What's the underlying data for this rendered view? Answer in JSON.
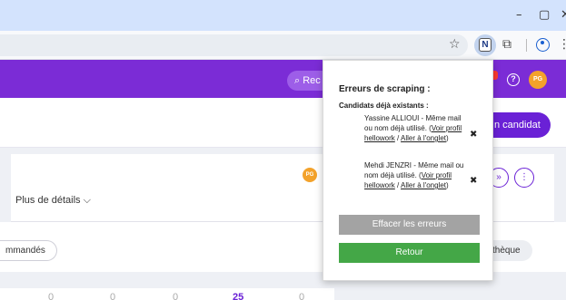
{
  "browser": {
    "window_controls": {
      "minimize": "–",
      "restore": "▢",
      "close": "✕"
    },
    "extension_letter": "N"
  },
  "app": {
    "search_label": "Rec",
    "avatar_initials": "PG",
    "add_button_label": "n candidat"
  },
  "main": {
    "card_avatar_initials": "PG",
    "details_label": "Plus de détails",
    "chip_left_label": "mmandés",
    "chip_right_label": "thèque",
    "stats": [
      "0",
      "0",
      "0",
      "25",
      "0"
    ]
  },
  "popup": {
    "title": "Erreurs de scraping :",
    "subtitle": "Candidats déjà existants :",
    "errors": [
      {
        "text": "Yassine ALLIOUI - Même mail ou nom déjà utilisé.",
        "link_profile": "Voir profil hellowork",
        "link_tab": "Aller à l'onglet"
      },
      {
        "text": "Mehdi JENZRI - Même mail ou nom déjà utilisé.",
        "link_profile": "Voir profil hellowork",
        "link_tab": "Aller à l'onglet"
      }
    ],
    "clear_button": "Effacer les erreurs",
    "back_button": "Retour"
  }
}
